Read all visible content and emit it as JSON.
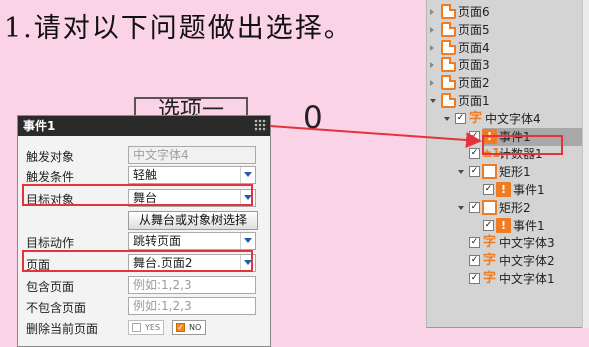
{
  "stage": {
    "question": "1.请对以下问题做出选择。",
    "option_label": "选项一",
    "counter_value": "0"
  },
  "panel": {
    "title": "事件1",
    "fields": {
      "trigger_object": {
        "label": "触发对象",
        "value": "中文字体4"
      },
      "trigger_condition": {
        "label": "触发条件",
        "value": "轻触"
      },
      "target_object": {
        "label": "目标对象",
        "value": "舞台"
      },
      "select_button": "从舞台或对象树选择",
      "target_action": {
        "label": "目标动作",
        "value": "跳转页面"
      },
      "page": {
        "label": "页面",
        "value": "舞台.页面2"
      },
      "include_page": {
        "label": "包含页面",
        "placeholder": "例如:1,2,3"
      },
      "exclude_page": {
        "label": "不包含页面",
        "placeholder": "例如:1,2,3"
      },
      "delete_current": {
        "label": "删除当前页面",
        "yes": "YES",
        "no": "NO",
        "selected": "NO"
      }
    }
  },
  "tree": {
    "items": [
      {
        "label": "页面6",
        "type": "page",
        "state": "collapsed",
        "checked": false
      },
      {
        "label": "页面5",
        "type": "page",
        "state": "collapsed",
        "checked": false
      },
      {
        "label": "页面4",
        "type": "page",
        "state": "collapsed",
        "checked": false
      },
      {
        "label": "页面3",
        "type": "page",
        "state": "collapsed",
        "checked": false
      },
      {
        "label": "页面2",
        "type": "page",
        "state": "collapsed",
        "checked": false
      },
      {
        "label": "页面1",
        "type": "page",
        "state": "expanded",
        "checked": false
      },
      {
        "label": "中文字体4",
        "type": "text",
        "state": "expanded",
        "checked": true
      },
      {
        "label": "事件1",
        "type": "event",
        "state": "leaf",
        "checked": true,
        "selected": true
      },
      {
        "label": "计数器1",
        "type": "counter",
        "state": "leaf",
        "checked": true
      },
      {
        "label": "矩形1",
        "type": "rect",
        "state": "expanded",
        "checked": true
      },
      {
        "label": "事件1",
        "type": "event",
        "state": "leaf",
        "checked": true
      },
      {
        "label": "矩形2",
        "type": "rect",
        "state": "expanded",
        "checked": true
      },
      {
        "label": "事件1",
        "type": "event",
        "state": "leaf",
        "checked": true
      },
      {
        "label": "中文字体3",
        "type": "text",
        "state": "leaf",
        "checked": true
      },
      {
        "label": "中文字体2",
        "type": "text",
        "state": "leaf",
        "checked": true
      },
      {
        "label": "中文字体1",
        "type": "text",
        "state": "leaf",
        "checked": true
      }
    ],
    "icon_glyphs": {
      "text": "字",
      "event": "!",
      "counter": "±1"
    }
  },
  "colors": {
    "stage_bg": "#fbd3e6",
    "highlight": "#e5333b",
    "accent": "#ef7b22",
    "panel_title_bg": "#2a2a2a"
  }
}
